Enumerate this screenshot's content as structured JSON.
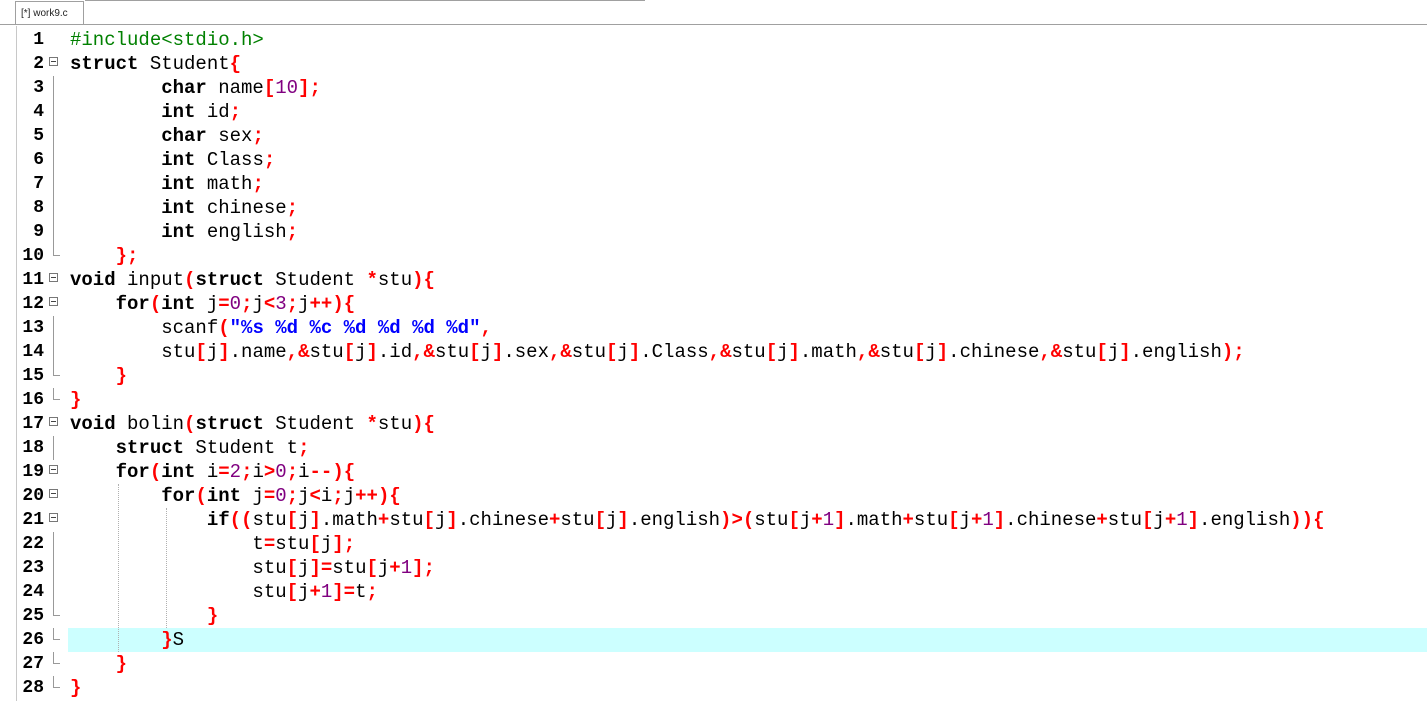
{
  "tab": {
    "title": "[*] work9.c"
  },
  "editor": {
    "current_line": 26,
    "lines": [
      {
        "n": "1",
        "text": "#include<stdio.h>"
      },
      {
        "n": "2",
        "text": "struct Student{"
      },
      {
        "n": "3",
        "text": "        char name[10];"
      },
      {
        "n": "4",
        "text": "        int id;"
      },
      {
        "n": "5",
        "text": "        char sex;"
      },
      {
        "n": "6",
        "text": "        int Class;"
      },
      {
        "n": "7",
        "text": "        int math;"
      },
      {
        "n": "8",
        "text": "        int chinese;"
      },
      {
        "n": "9",
        "text": "        int english;"
      },
      {
        "n": "10",
        "text": "    };"
      },
      {
        "n": "11",
        "text": "void input(struct Student *stu){"
      },
      {
        "n": "12",
        "text": "    for(int j=0;j<3;j++){"
      },
      {
        "n": "13",
        "text": "        scanf(\"%s %d %c %d %d %d %d\","
      },
      {
        "n": "14",
        "text": "        stu[j].name,&stu[j].id,&stu[j].sex,&stu[j].Class,&stu[j].math,&stu[j].chinese,&stu[j].english);"
      },
      {
        "n": "15",
        "text": "    }"
      },
      {
        "n": "16",
        "text": "}"
      },
      {
        "n": "17",
        "text": "void bolin(struct Student *stu){"
      },
      {
        "n": "18",
        "text": "    struct Student t;"
      },
      {
        "n": "19",
        "text": "    for(int i=2;i>0;i--){"
      },
      {
        "n": "20",
        "text": "        for(int j=0;j<i;j++){"
      },
      {
        "n": "21",
        "text": "            if((stu[j].math+stu[j].chinese+stu[j].english)>(stu[j+1].math+stu[j+1].chinese+stu[j+1].english)){"
      },
      {
        "n": "22",
        "text": "                t=stu[j];"
      },
      {
        "n": "23",
        "text": "                stu[j]=stu[j+1];"
      },
      {
        "n": "24",
        "text": "                stu[j+1]=t;"
      },
      {
        "n": "25",
        "text": "            }"
      },
      {
        "n": "26",
        "text": "        }S"
      },
      {
        "n": "27",
        "text": "    }"
      },
      {
        "n": "28",
        "text": "}"
      }
    ]
  },
  "fold": {
    "starts": [
      2,
      11,
      12,
      17,
      19,
      20,
      21
    ],
    "ends": [
      10,
      15,
      16,
      25,
      26,
      27,
      28
    ]
  },
  "colors": {
    "keyword": "#000000",
    "preprocessor": "#008000",
    "operator": "#ff0000",
    "number": "#800080",
    "string": "#0000ff",
    "current_line_bg": "#ccffff"
  }
}
